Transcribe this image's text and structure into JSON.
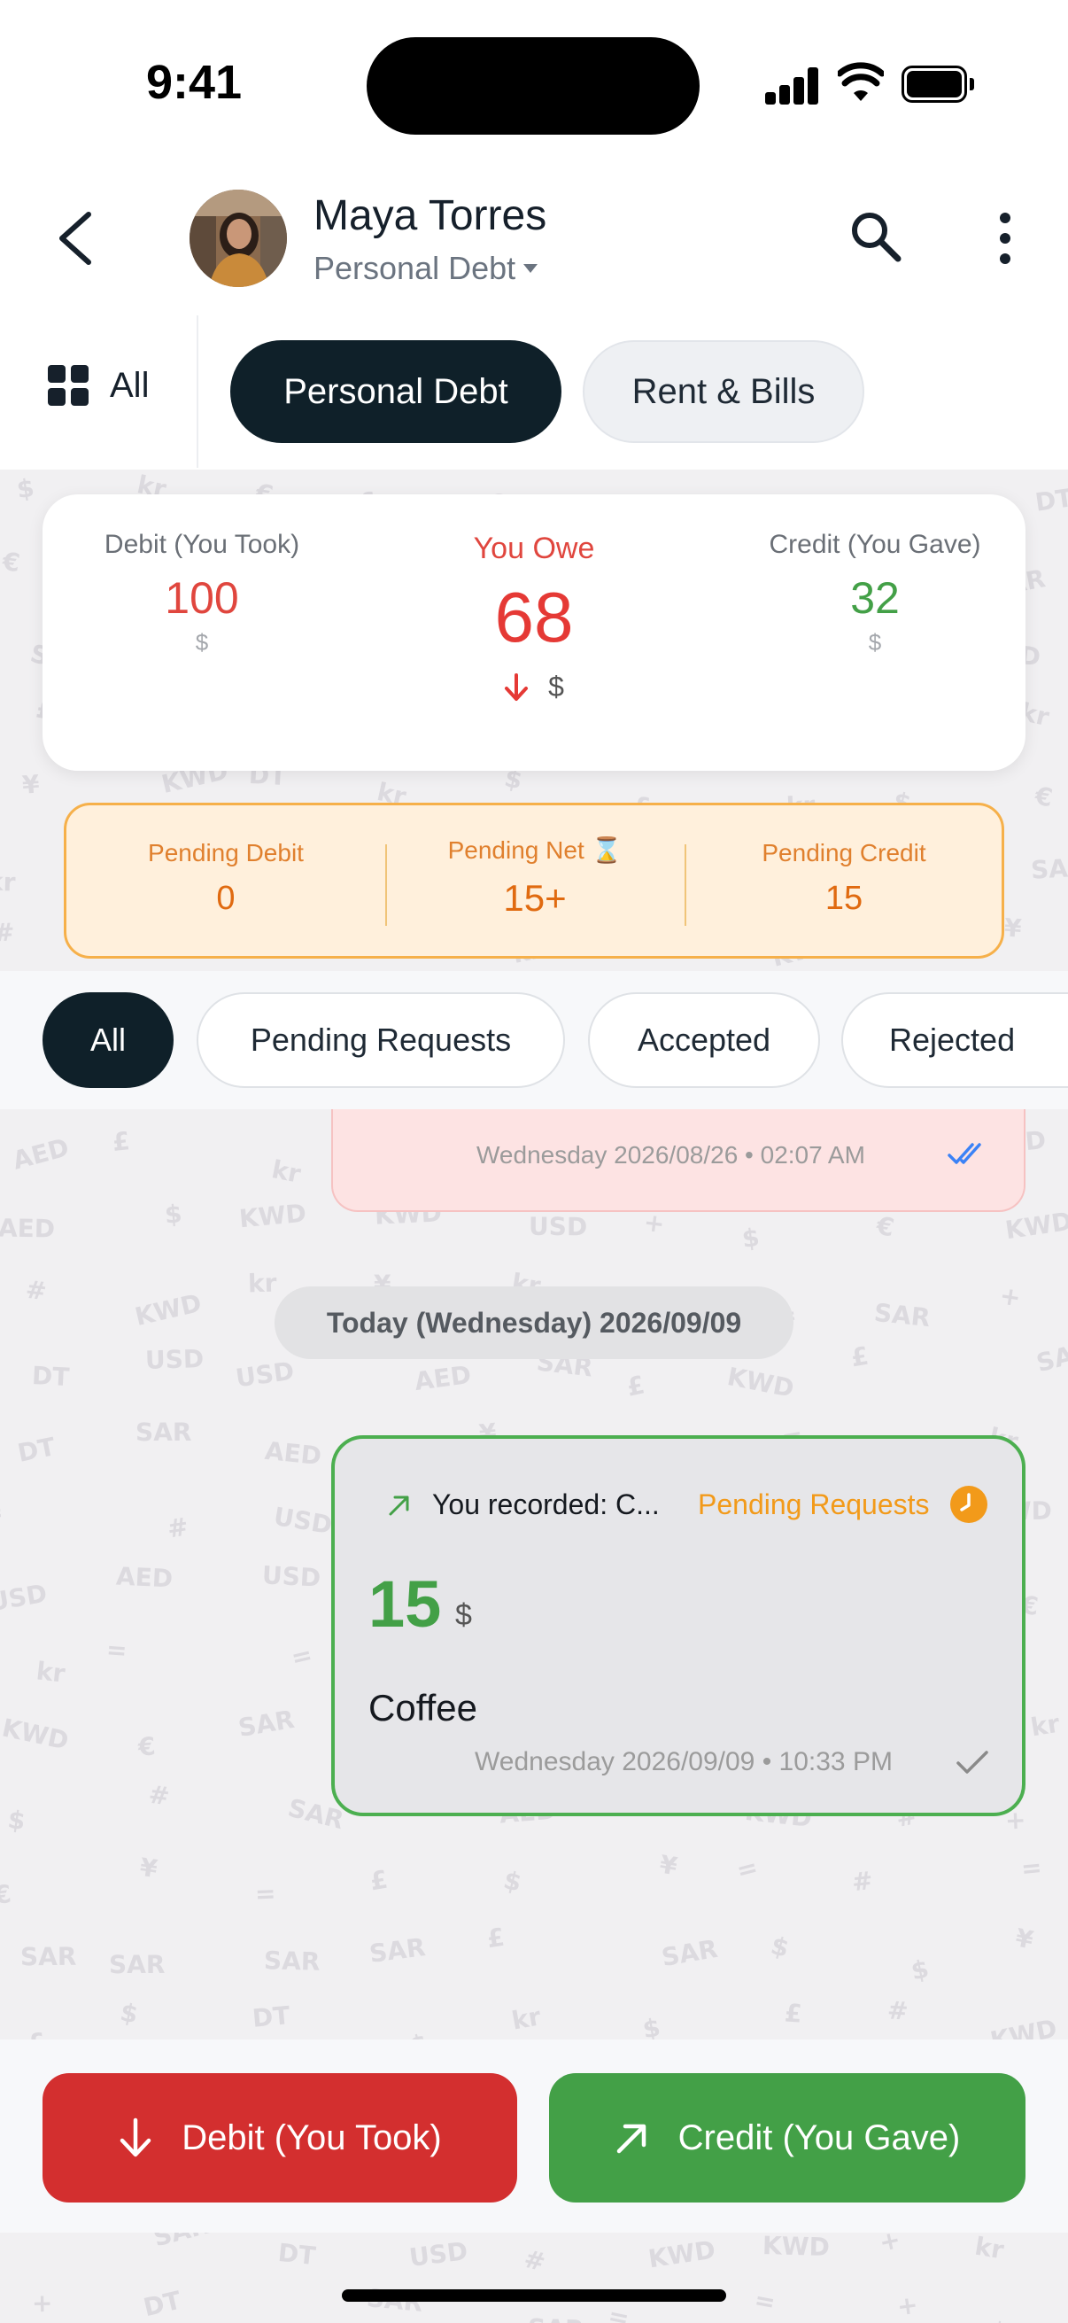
{
  "status_bar": {
    "time": "9:41"
  },
  "header": {
    "name": "Maya Torres",
    "subtitle": "Personal Debt"
  },
  "categories": {
    "all_label": "All",
    "tabs": [
      "Personal Debt",
      "Rent & Bills"
    ],
    "selected": "Personal Debt"
  },
  "summary": {
    "debit_label": "Debit (You Took)",
    "debit_value": "100",
    "debit_currency": "$",
    "net_label": "You Owe",
    "net_value": "68",
    "net_currency": "$",
    "credit_label": "Credit (You Gave)",
    "credit_value": "32",
    "credit_currency": "$"
  },
  "pending": {
    "debit_label": "Pending Debit",
    "debit_value": "0",
    "net_label": "Pending Net ⌛",
    "net_value": "15+",
    "credit_label": "Pending Credit",
    "credit_value": "15"
  },
  "filters": [
    "All",
    "Pending Requests",
    "Accepted",
    "Rejected"
  ],
  "previous_message": {
    "timestamp": "Wednesday 2026/08/26 • 02:07 AM"
  },
  "date_separator": "Today (Wednesday) 2026/09/09",
  "message": {
    "recorded": "You recorded: C...",
    "status": "Pending Requests",
    "amount": "15",
    "currency": "$",
    "note": "Coffee",
    "timestamp": "Wednesday 2026/09/09 • 10:33 PM"
  },
  "actions": {
    "debit": "Debit (You Took)",
    "credit": "Credit (You Gave)"
  },
  "colors": {
    "debit_red": "#d32f2f",
    "credit_green": "#43a047",
    "pending_orange": "#f29a1a",
    "dark_chip": "#0f2029"
  },
  "background_pattern_glyphs": [
    "AED",
    "KWD",
    "DT",
    "SAR",
    "USD",
    "kr",
    "$",
    "€",
    "£",
    "¥",
    "#",
    "+",
    "="
  ]
}
